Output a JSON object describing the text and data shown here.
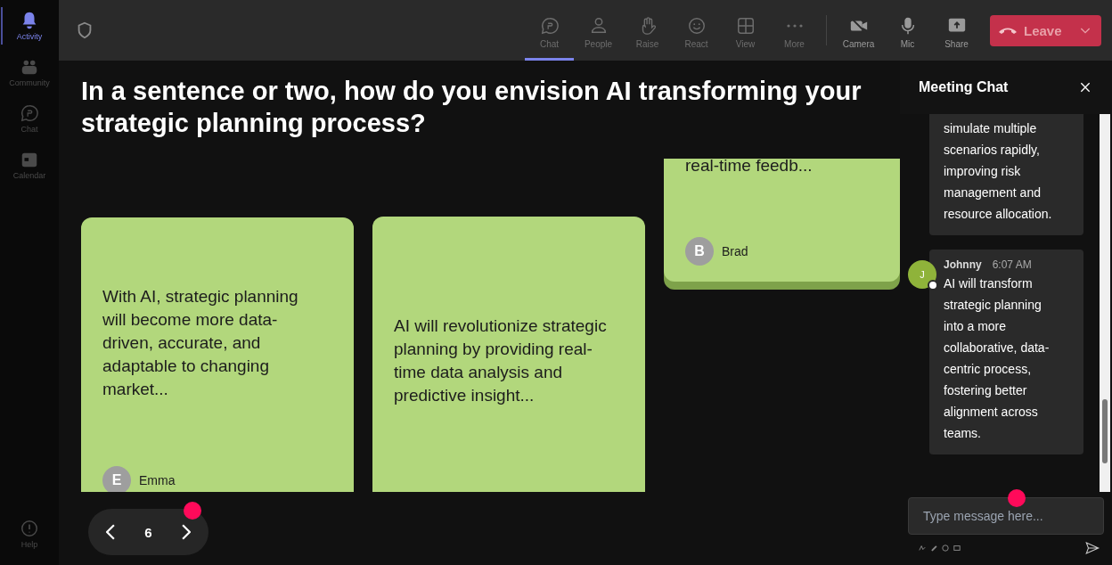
{
  "sidebar": {
    "items": [
      {
        "label": "Activity",
        "kind": "bell",
        "selected": true
      },
      {
        "label": "Community",
        "kind": "people",
        "selected": false
      },
      {
        "label": "Chat",
        "kind": "chat",
        "selected": false
      },
      {
        "label": "Calendar",
        "kind": "calendar",
        "selected": false
      }
    ],
    "help": "Help"
  },
  "toolbar": {
    "items": [
      {
        "label": "Chat",
        "kind": "chat",
        "selected": true
      },
      {
        "label": "People",
        "kind": "person",
        "selected": false
      },
      {
        "label": "Raise",
        "kind": "hand",
        "selected": false
      },
      {
        "label": "React",
        "kind": "smile",
        "selected": false
      },
      {
        "label": "View",
        "kind": "grid",
        "selected": false
      },
      {
        "label": "More",
        "kind": "dots",
        "selected": false
      }
    ],
    "controls": [
      {
        "label": "Camera",
        "kind": "camera"
      },
      {
        "label": "Mic",
        "kind": "mic"
      },
      {
        "label": "Share",
        "kind": "share"
      }
    ],
    "leave": "Leave"
  },
  "question": "In a sentence or two, how do you envision AI transforming your strategic planning process?",
  "cards": [
    {
      "text": "With AI, strategic planning will become more data-driven, accurate, and adaptable to changing market...",
      "author": "Emma",
      "initial": "E"
    },
    {
      "text": "AI will revolutionize strategic planning by providing real-time data analysis and predictive insight..."
    },
    {
      "text": "real-time feedb...",
      "author": "Brad",
      "initial": "B"
    }
  ],
  "pager": {
    "page": "6"
  },
  "chat": {
    "title": "Meeting Chat",
    "messages": [
      {
        "text": "simulate multiple scenarios rapidly, improving risk management and resource allocation."
      },
      {
        "author": "Johnny",
        "initial": "J",
        "time": "6:07 AM",
        "text": "AI will transform strategic planning into a more collaborative, data-centric process, fostering better alignment across teams."
      }
    ],
    "input": {
      "placeholder": "Type message here..."
    }
  }
}
